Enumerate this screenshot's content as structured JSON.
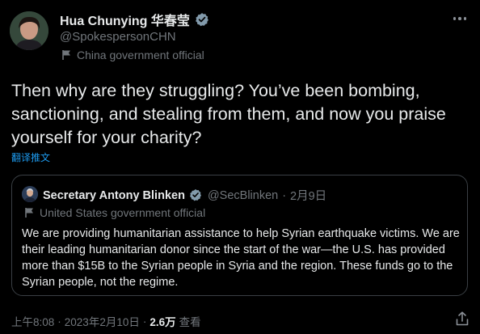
{
  "author": {
    "display_name": "Hua Chunying 华春莹",
    "handle": "@SpokespersonCHN",
    "label": "China government official",
    "verified_color": "#829aab"
  },
  "tweet": {
    "text": "Then why are they struggling? You’ve been bombing, sanctioning, and stealing from them, and now you praise yourself for your charity?",
    "translate_label": "翻译推文"
  },
  "quote": {
    "display_name": "Secretary Antony Blinken",
    "handle": "@SecBlinken",
    "separator": "·",
    "date": "2月9日",
    "label": "United States government official",
    "text": "We are providing humanitarian assistance to help Syrian earthquake victims. We are their leading humanitarian donor since the start of the war—the U.S. has provided more than $15B to the Syrian people in Syria and the region. These funds go to the Syrian people, not the regime."
  },
  "footer": {
    "time": "上午8:08",
    "separator": "·",
    "date": "2023年2月10日",
    "separator2": "·",
    "views_count": "2.6万",
    "views_label": "查看"
  },
  "icons": {
    "more": "more-horizontal-icon",
    "verified": "verified-badge-icon",
    "government_label": "flag-icon",
    "share": "share-icon"
  },
  "colors": {
    "background": "#000000",
    "text": "#e7e9ea",
    "secondary": "#71767b",
    "link": "#1d9bf0",
    "border": "#3a3f44"
  }
}
